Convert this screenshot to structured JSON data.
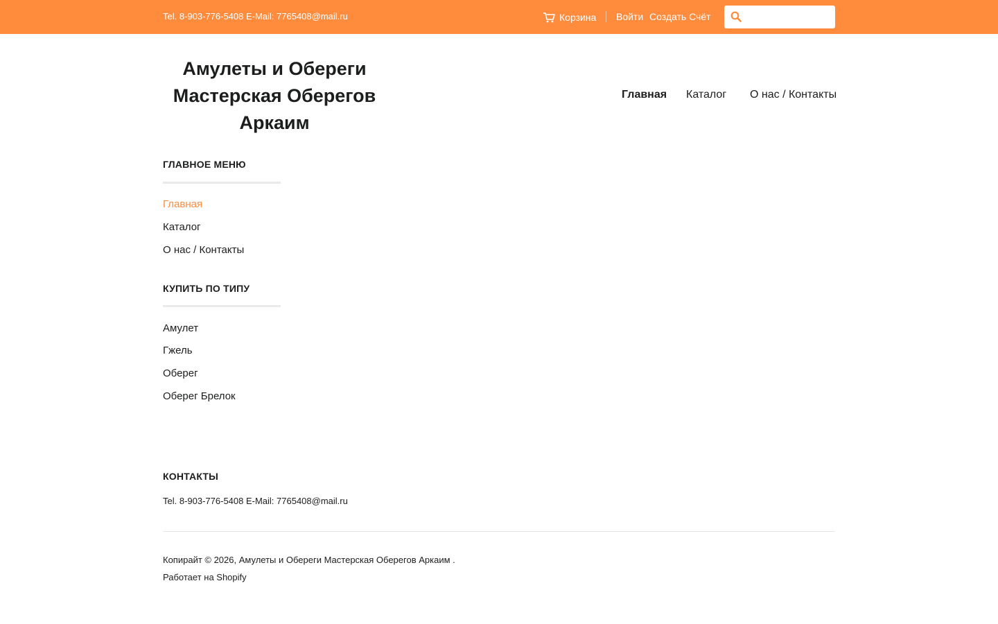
{
  "topbar": {
    "contact": "Tel. 8-903-776-5408 E-Mail: 7765408@mail.ru",
    "cart_label": "Корзина",
    "login_label": "Войти",
    "register_label": "Создать Счёт",
    "search_placeholder": "",
    "background_color": "#ff8b3d"
  },
  "header": {
    "logo_line1": "Амулеты и Обереги",
    "logo_line2": "Мастерская Оберегов",
    "logo_line3": "Аркаим"
  },
  "main_nav": {
    "home": "Главная",
    "catalog": "Каталог",
    "about": "О нас / Контакты"
  },
  "sidebar": {
    "main_menu_title": "Главное меню",
    "main_menu_items": [
      "Главная",
      "Каталог",
      "О нас / Контакты"
    ],
    "shop_by_type_title": "Купить по типу",
    "shop_by_type_items": [
      "Амулет",
      "Гжель",
      "Оберег",
      "Оберег Брелок"
    ]
  },
  "footer": {
    "contacts_title": "Контакты",
    "contacts_text": "Tel. 8-903-776-5408 E-Mail: 7765408@mail.ru",
    "copyright": "Копирайт © 2026, Амулеты и Обереги Мастерская Оберегов Аркаим .",
    "powered_by": "Работает на Shopify"
  },
  "colors": {
    "accent": "#ff8b3d",
    "text": "#1c1d1d",
    "rule": "#eaeaea"
  },
  "icons": {
    "cart": "cart-icon",
    "search": "search-icon"
  }
}
